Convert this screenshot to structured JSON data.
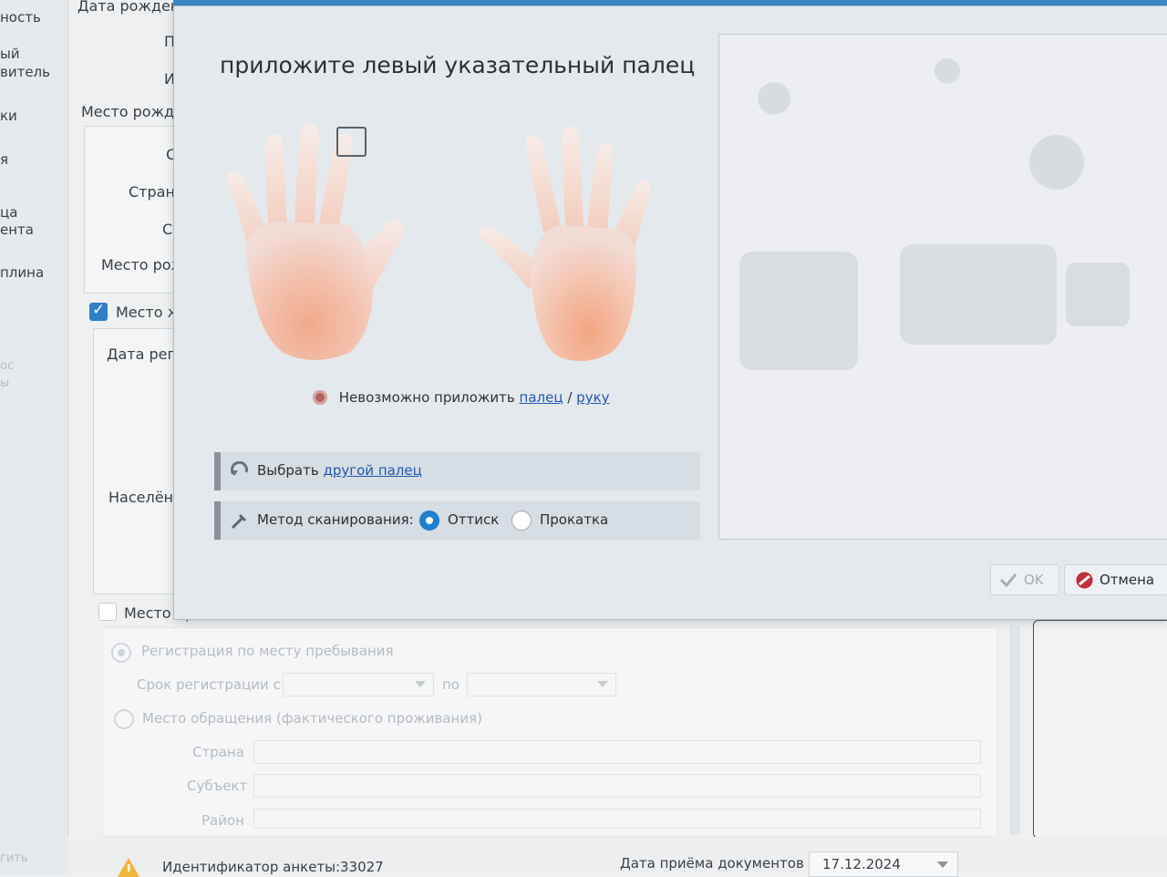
{
  "sidebar": {
    "items": [
      "ность",
      "ый",
      "витель",
      "ки",
      "я",
      "ца",
      "ента",
      "плина",
      "ос",
      "ы"
    ],
    "footer": "гить"
  },
  "form": {
    "birth_date_label": "Дата рожден",
    "short_p": "П",
    "short_i": "И",
    "birth_place_label": "Место рожде",
    "short_s": "С",
    "country_label": "Страна",
    "subject_short": "Су",
    "birth_place2_label": "Место рож,",
    "residence_checkbox_label": "Место жи",
    "reg_date_label": "Дата регис",
    "short_c": "(",
    "locality_label": "Населённы",
    "stay_checkbox_label": "Место пр"
  },
  "faded_section": {
    "reg_stay": "Регистрация по месту пребывания",
    "reg_period_from": "Срок регистрации с",
    "to": "по",
    "actual_place": "Место обращения (фактического проживания)",
    "country": "Страна",
    "subject": "Субъект",
    "district": "Район"
  },
  "bottom": {
    "questionnaire_id_label": "Идентификатор анкеты:",
    "questionnaire_id": "33027",
    "doc_date_label": "Дата приёма документов",
    "doc_date": "17.12.2024"
  },
  "dialog": {
    "prompt": "приложите левый указательный палец",
    "cant_apply_text": "Невозможно приложить",
    "finger_link": "палец",
    "slash": "/",
    "hand_link": "руку",
    "choose_text": "Выбрать",
    "other_finger_link": "другой палец",
    "scan_method_label": "Метод сканирования:",
    "method_options": [
      "Оттиск",
      "Прокатка"
    ],
    "selected_method": "Оттиск",
    "ok_label": "OK",
    "cancel_label": "Отмена",
    "accent_color": "#1f7fd0",
    "link_color": "#2257b3"
  },
  "icons": {
    "check": "check-icon",
    "cancel": "no-entry-icon",
    "warning": "warning-icon",
    "finger": "fingerprint-icon",
    "rotate": "rotate-icon",
    "scanner": "scanner-icon"
  }
}
